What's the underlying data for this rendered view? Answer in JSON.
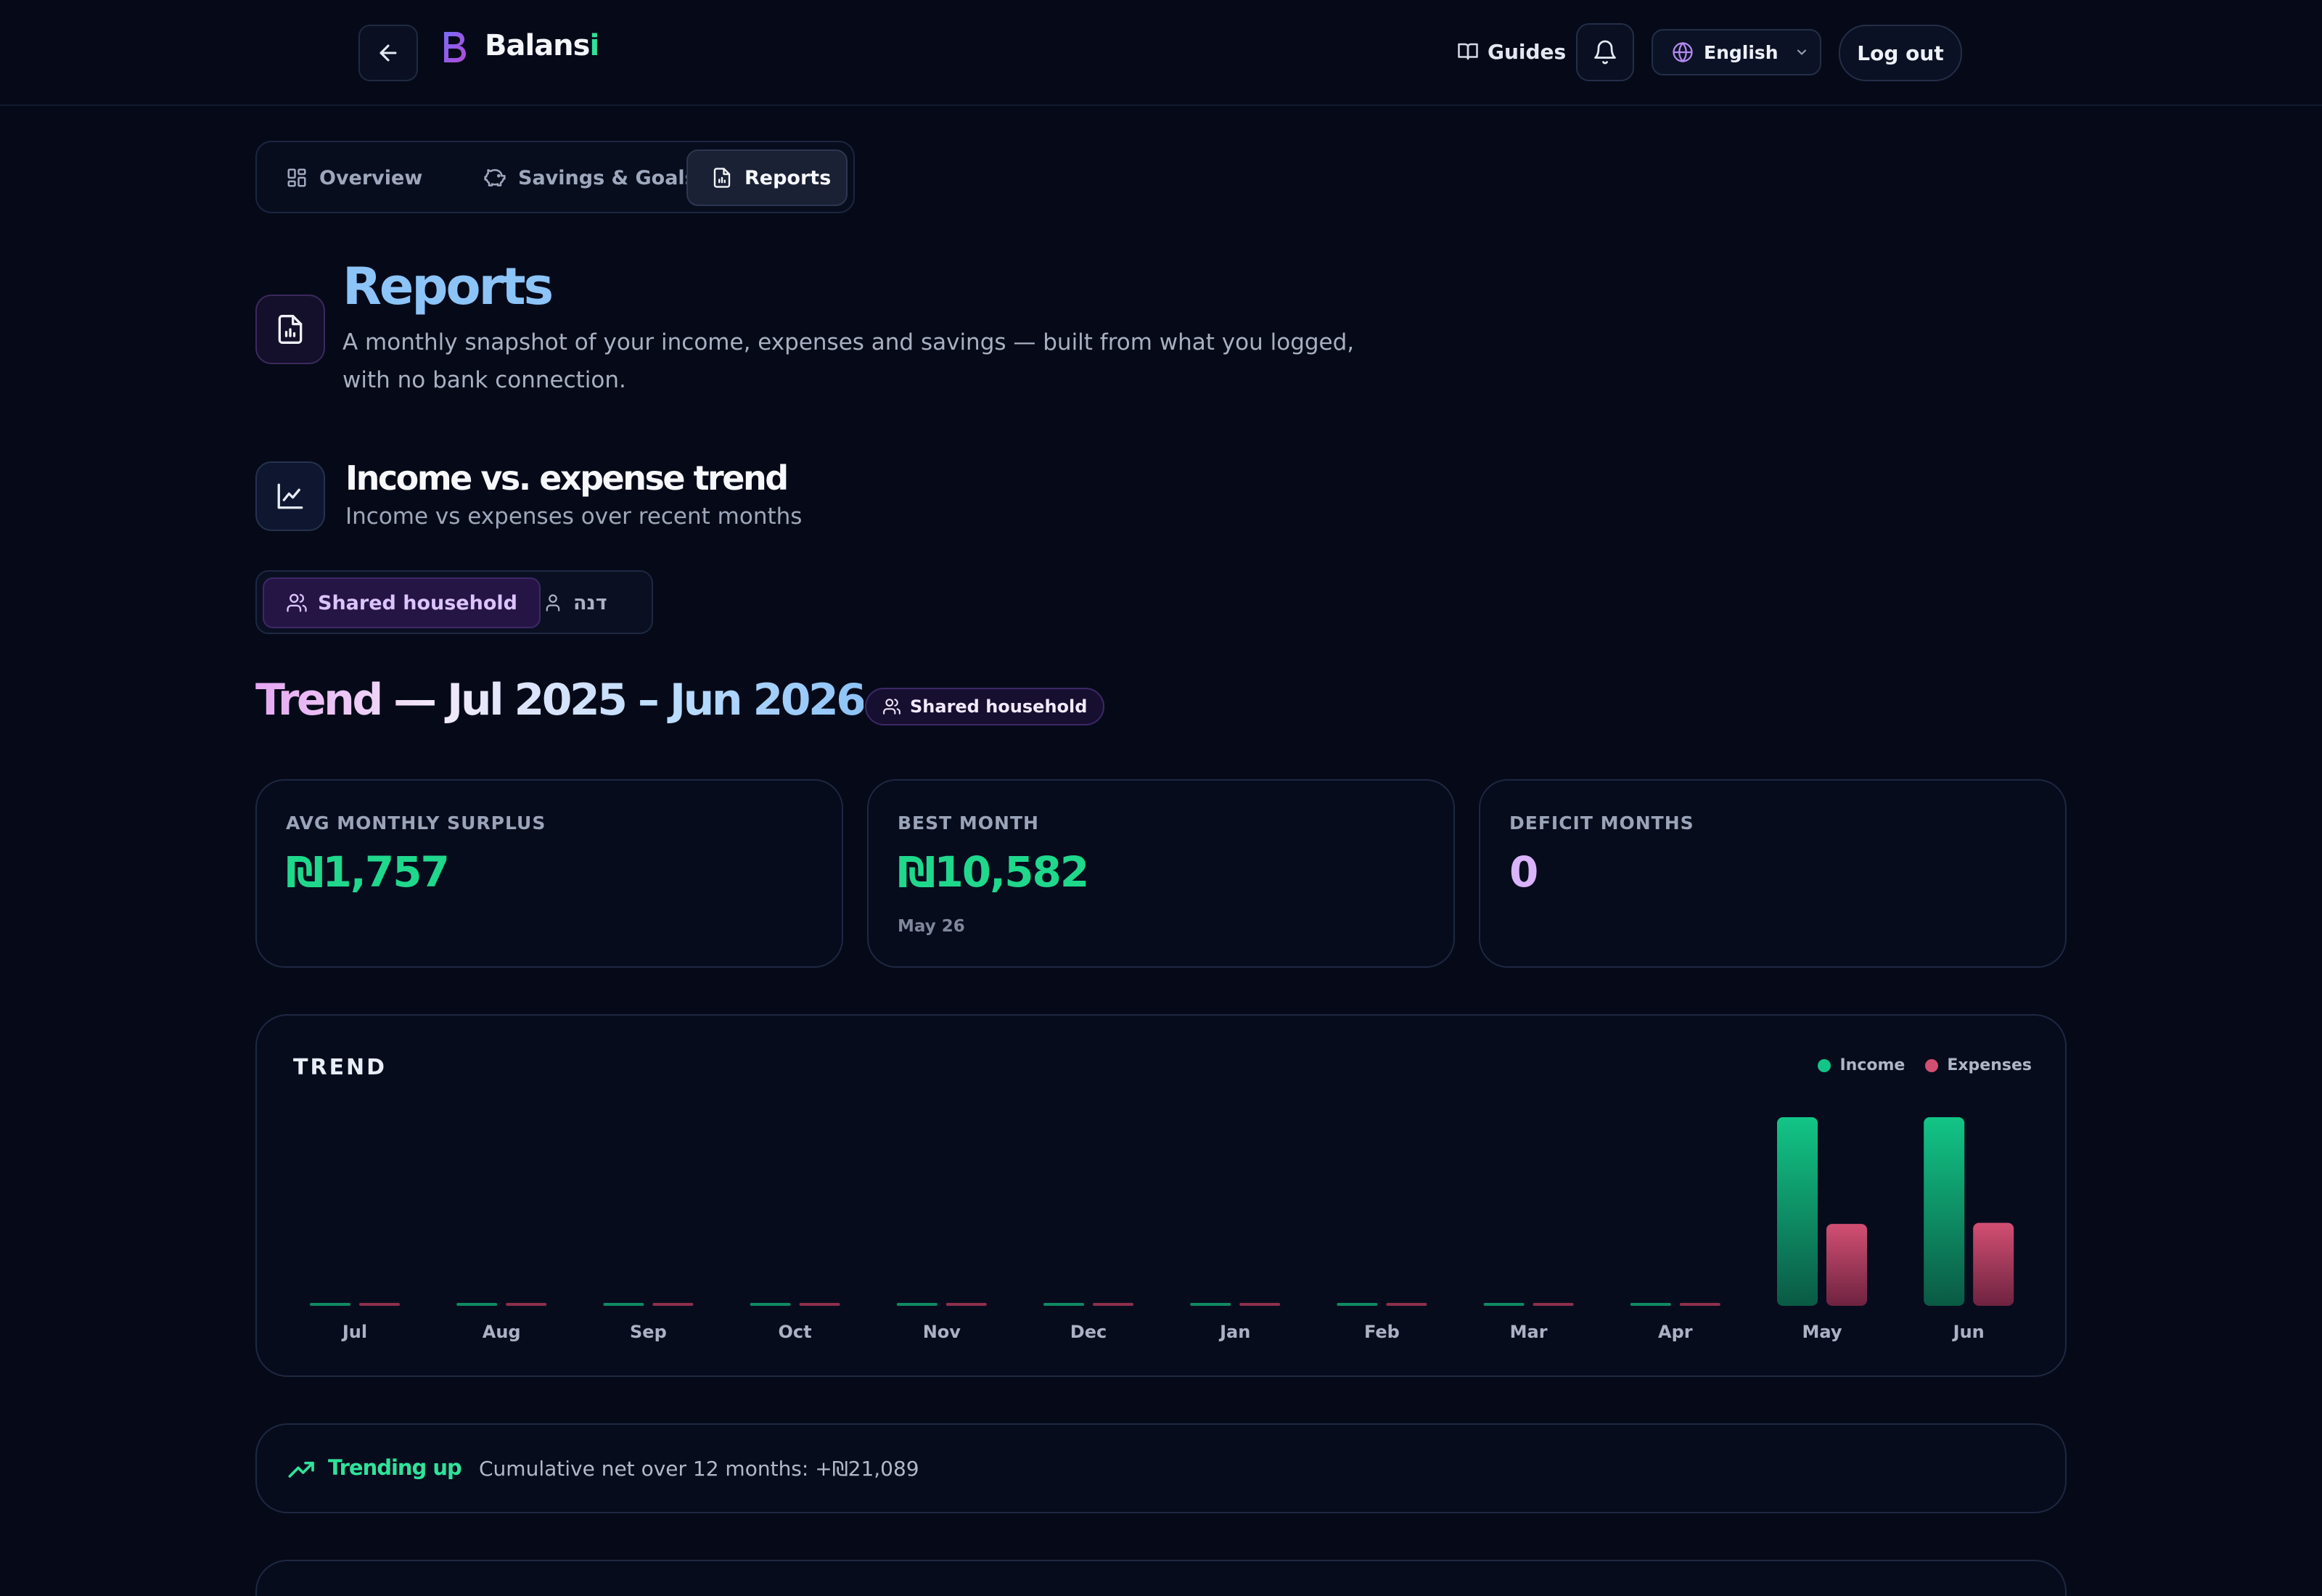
{
  "header": {
    "logo_text": "Balans",
    "logo_accent": "i",
    "guides_label": "Guides",
    "language": "English",
    "logout_label": "Log out"
  },
  "tabs": [
    {
      "label": "Overview",
      "icon": "grid-icon"
    },
    {
      "label": "Savings & Goals",
      "icon": "piggy-bank-icon"
    },
    {
      "label": "Reports",
      "icon": "report-icon",
      "active": true
    }
  ],
  "page": {
    "title": "Reports",
    "description": "A monthly snapshot of your income, expenses and savings — built from what you logged, with no bank connection."
  },
  "section": {
    "title": "Income vs. expense trend",
    "subtitle": "Income vs expenses over recent months"
  },
  "scope": {
    "options": [
      "Shared household",
      "דנה"
    ],
    "selected": "Shared household"
  },
  "trend": {
    "title": "Trend — Jul 2025 – Jun 2026",
    "badge": "Shared household"
  },
  "stats": [
    {
      "label": "AVG MONTHLY SURPLUS",
      "value": "₪1,757",
      "sub": "",
      "color": "#1fd88c"
    },
    {
      "label": "BEST MONTH",
      "value": "₪10,582",
      "sub": "May 26",
      "color": "#1fd88c"
    },
    {
      "label": "DEFICIT MONTHS",
      "value": "0",
      "sub": "",
      "color": "#d9b3fb"
    }
  ],
  "chart_data": {
    "type": "bar",
    "title": "TREND",
    "categories": [
      "Jul",
      "Aug",
      "Sep",
      "Oct",
      "Nov",
      "Dec",
      "Jan",
      "Feb",
      "Mar",
      "Apr",
      "May",
      "Jun"
    ],
    "series": [
      {
        "name": "Income",
        "color": "#12c586",
        "values": [
          0,
          0,
          0,
          0,
          0,
          0,
          0,
          0,
          0,
          0,
          17500,
          17500
        ]
      },
      {
        "name": "Expenses",
        "color": "#d24f72",
        "values": [
          0,
          0,
          0,
          0,
          0,
          0,
          0,
          0,
          0,
          0,
          7600,
          7700
        ]
      }
    ],
    "ylim": [
      0,
      17500
    ],
    "grid": false,
    "legend": "top-right"
  },
  "trending": {
    "label": "Trending up",
    "text": "Cumulative net over 12 months: +₪21,089"
  },
  "colors": {
    "background": "#060a18",
    "income": "#12c586",
    "expenses": "#d24f72",
    "accent_purple": "#dcc3fb",
    "accent_blue": "#8cc4f8"
  }
}
